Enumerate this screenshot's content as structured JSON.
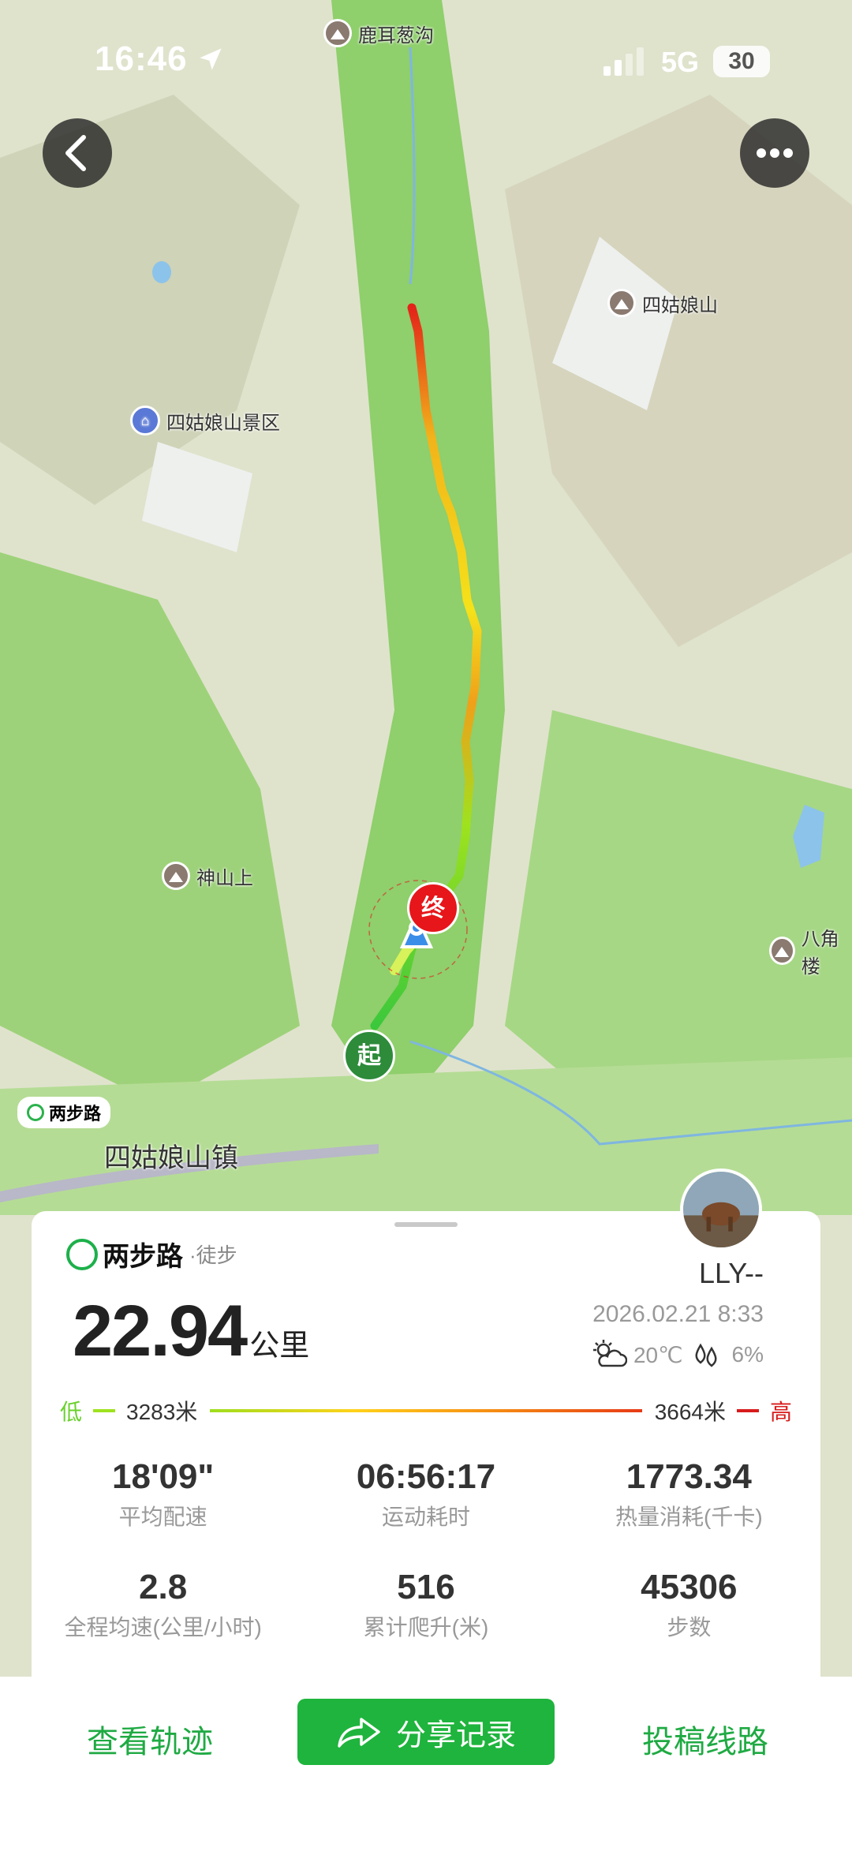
{
  "status_bar": {
    "time": "16:46",
    "network": "5G",
    "battery": "30"
  },
  "map": {
    "places": {
      "luer": "鹿耳葱沟",
      "sigu_peak": "四姑娘山",
      "scenic": "四姑娘山景区",
      "shenshan": "神山上",
      "bajiao": "八角楼",
      "town": "四姑娘山镇"
    },
    "start_label": "起",
    "end_label": "终",
    "watermark": "两步路"
  },
  "record": {
    "brand": "两步路",
    "type": "·徒步",
    "distance": "22.94",
    "distance_unit": "公里",
    "username": "LLY--",
    "datetime": "2026.02.21 8:33",
    "temperature": "20℃",
    "humidity": "6%",
    "elevation": {
      "low_label": "低",
      "low_value": "3283米",
      "high_value": "3664米",
      "high_label": "高"
    },
    "stats": [
      {
        "value": "18'09\"",
        "label": "平均配速"
      },
      {
        "value": "06:56:17",
        "label": "运动耗时"
      },
      {
        "value": "1773.34",
        "label": "热量消耗(千卡)"
      },
      {
        "value": "2.8",
        "label": "全程均速(公里/小时)"
      },
      {
        "value": "516",
        "label": "累计爬升(米)"
      },
      {
        "value": "45306",
        "label": "步数"
      }
    ]
  },
  "actions": {
    "view_track": "查看轨迹",
    "share": "分享记录",
    "submit_route": "投稿线路"
  },
  "colors": {
    "brand_green": "#1fb43d",
    "low": "#6ad12e",
    "high": "#d81c1c"
  }
}
